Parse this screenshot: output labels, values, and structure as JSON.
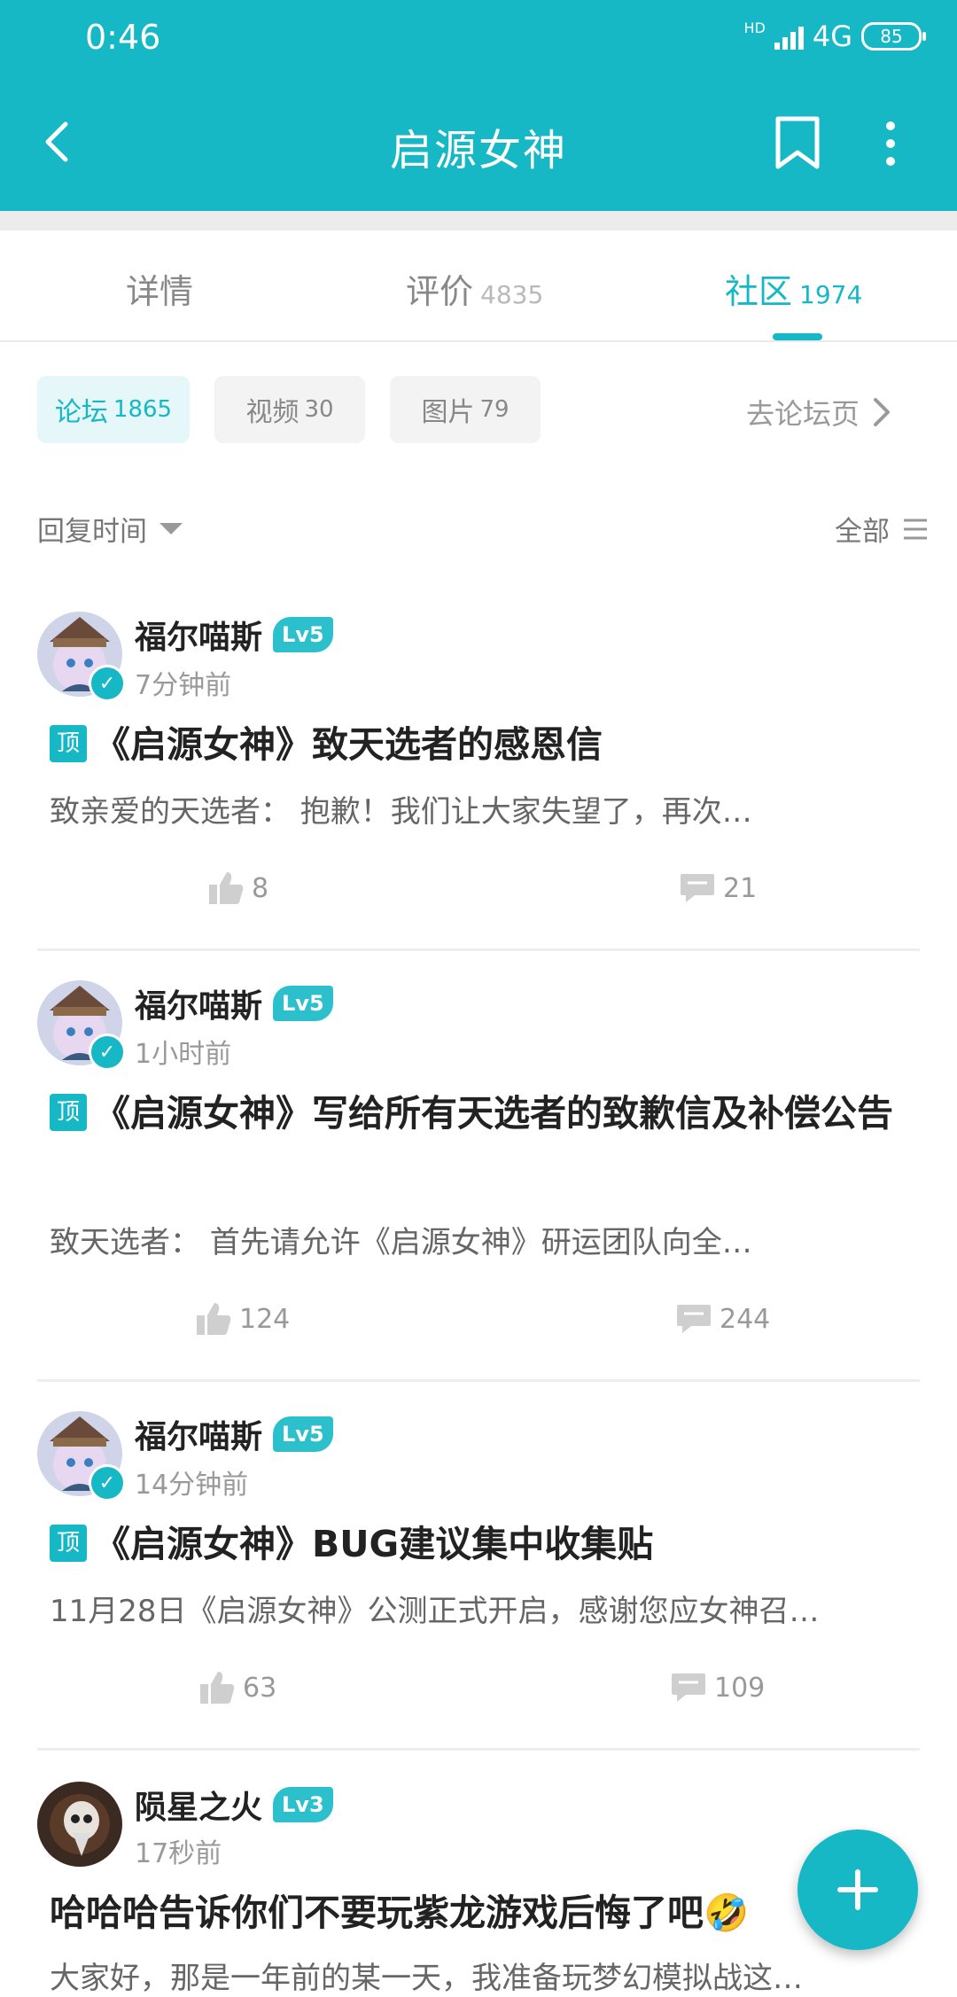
{
  "status_bar": {
    "time": "0:46",
    "network": "4G",
    "hd": "HD",
    "battery": "85"
  },
  "header": {
    "title": "启源女神"
  },
  "tabs": [
    {
      "label": "详情",
      "count": ""
    },
    {
      "label": "评价",
      "count": "4835"
    },
    {
      "label": "社区",
      "count": "1974"
    }
  ],
  "filters": {
    "chips": [
      {
        "label": "论坛",
        "count": "1865"
      },
      {
        "label": "视频",
        "count": "30"
      },
      {
        "label": "图片",
        "count": "79"
      }
    ],
    "goto_forum": "去论坛页",
    "sort_label": "回复时间",
    "scope_label": "全部"
  },
  "posts": [
    {
      "author": "福尔喵斯",
      "level": "Lv5",
      "time": "7分钟前",
      "badge": "顶",
      "title": "《启源女神》致天选者的感恩信",
      "excerpt": "致亲爱的天选者：            抱歉！我们让大家失望了，再次…",
      "likes": "8",
      "comments": "21"
    },
    {
      "author": "福尔喵斯",
      "level": "Lv5",
      "time": "1小时前",
      "badge": "顶",
      "title": "《启源女神》写给所有天选者的致歉信及补偿公告",
      "excerpt": "致天选者：         首先请允许《启源女神》研运团队向全…",
      "likes": "124",
      "comments": "244"
    },
    {
      "author": "福尔喵斯",
      "level": "Lv5",
      "time": "14分钟前",
      "badge": "顶",
      "title": "《启源女神》BUG建议集中收集贴",
      "excerpt": "11月28日《启源女神》公测正式开启，感谢您应女神召…",
      "likes": "63",
      "comments": "109"
    },
    {
      "author": "陨星之火",
      "level": "Lv3",
      "time": "17秒前",
      "title": "哈哈哈告诉你们不要玩紫龙游戏后悔了吧🤣",
      "excerpt": "大家好，那是一年前的某一天，我准备玩梦幻模拟战这…"
    }
  ],
  "colors": {
    "accent": "#16b8c6",
    "text": "#222222",
    "muted": "#999999"
  }
}
